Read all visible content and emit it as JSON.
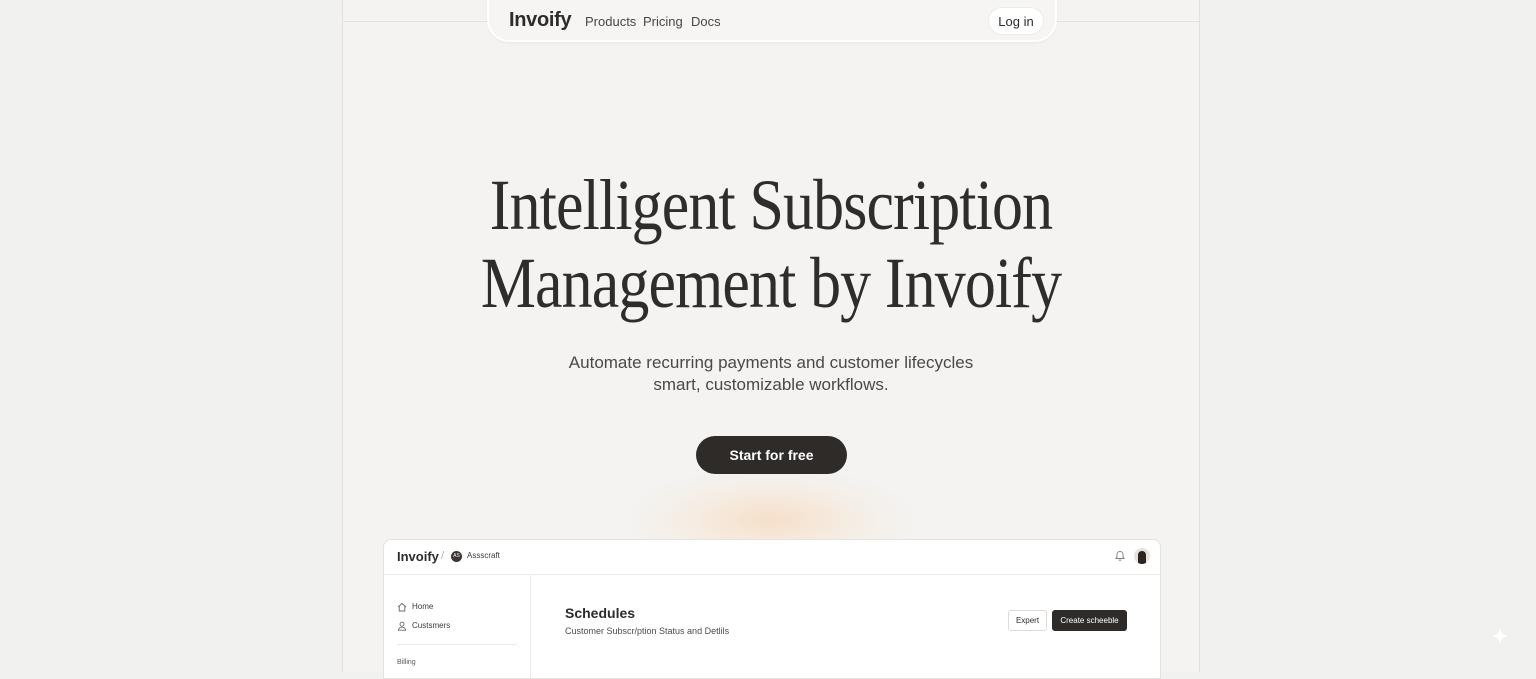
{
  "nav": {
    "brand": "Invoify",
    "links": [
      "Products",
      "Pricing",
      "Docs"
    ],
    "login_label": "Log in"
  },
  "hero": {
    "title_lines": [
      "Intelligent Subscription",
      "Management by Invoify"
    ],
    "subtitle_lines": [
      "Automate recurring payments and customer lifecycles",
      "smart, customizable workflows."
    ],
    "cta_label": "Start for free"
  },
  "app_preview": {
    "brand": "Invoify",
    "separator": "/",
    "workspace_initials": "AS",
    "workspace_name": "Assscraft",
    "icons": [
      "home-icon",
      "user-icon",
      "bell-icon"
    ],
    "sidebar": {
      "items": [
        "Home",
        "Custsmers"
      ],
      "section_label": "Billing"
    },
    "page_title": "Schedules",
    "page_description": "Customer Subscr/ption Status and Detlils",
    "export_label": "Expert",
    "create_label": "Create scheeble"
  },
  "colors": {
    "page_bg": "#f1f1ef",
    "frame_bg": "#f4f3f1",
    "primary_dark": "#2f2b28",
    "text": "#2f2c2a"
  }
}
